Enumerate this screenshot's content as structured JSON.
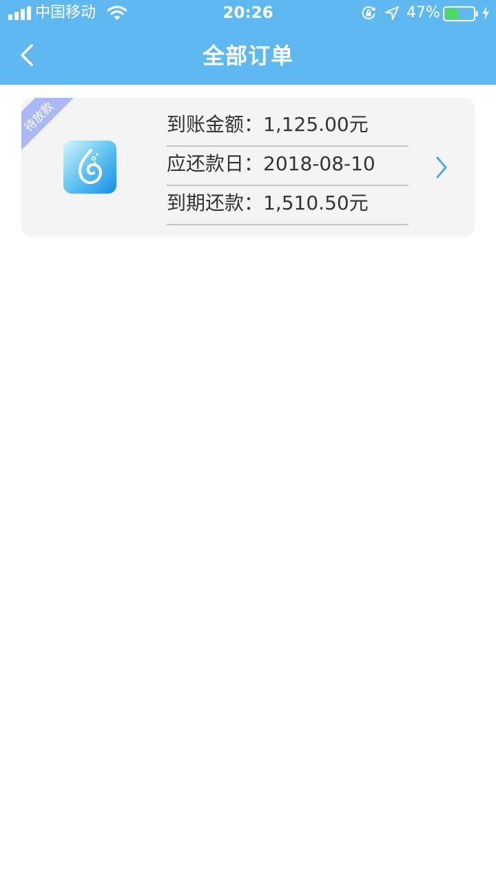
{
  "status_bar": {
    "carrier": "中国移动",
    "time": "20:26",
    "battery_percent": "47%",
    "battery_level": 0.47
  },
  "nav": {
    "title": "全部订单"
  },
  "order": {
    "badge": "待放款",
    "rows": [
      {
        "label": "到账金额：",
        "value": "1,125.00元"
      },
      {
        "label": "应还款日：",
        "value": "2018-08-10"
      },
      {
        "label": "到期还款：",
        "value": "1,510.50元"
      }
    ]
  },
  "colors": {
    "accent": "#5fb8f0",
    "badge": "#aab8f5",
    "chevron": "#4aa8e8",
    "battery_fill": "#4cd964"
  }
}
